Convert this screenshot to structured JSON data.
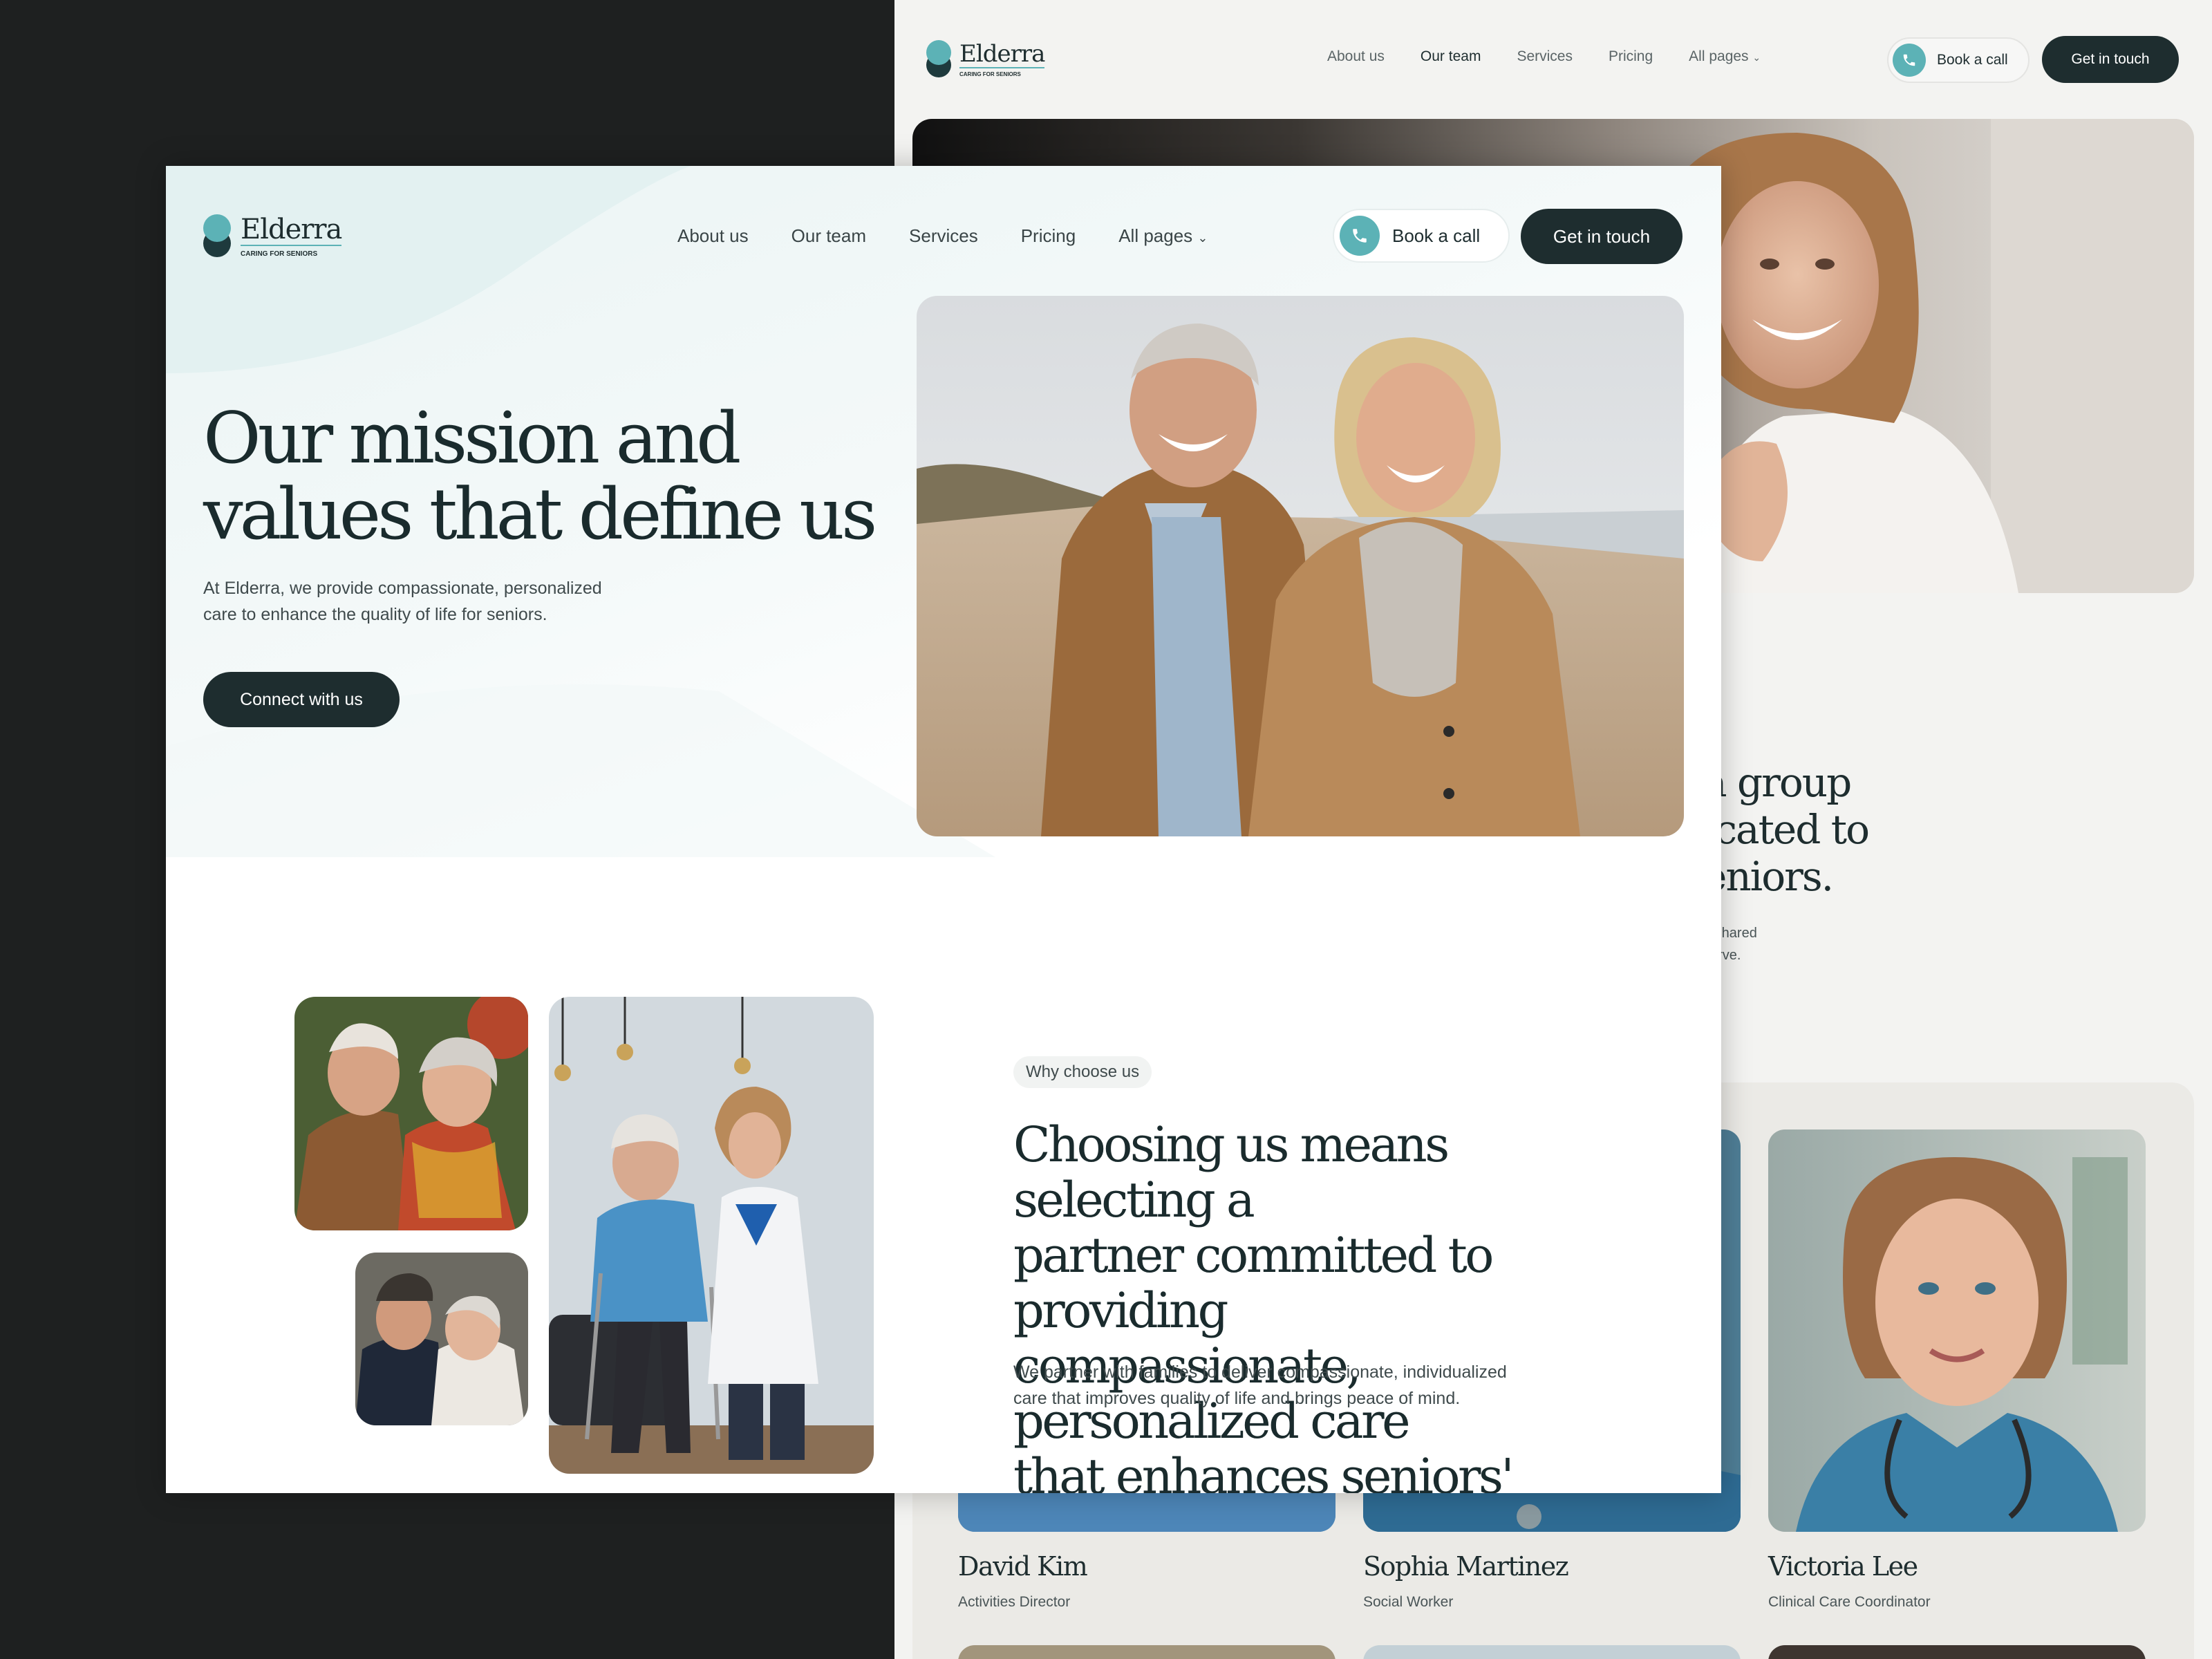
{
  "brand": {
    "name": "Elderra",
    "tagline": "CARING FOR SENIORS"
  },
  "colors": {
    "accent": "#5cb2b6",
    "dark": "#1e2d2f",
    "page_bg": "#1e2020"
  },
  "bg_page": {
    "nav": {
      "links": [
        "About us",
        "Our team",
        "Services",
        "Pricing",
        "All pages"
      ],
      "active": "Our team",
      "book_call": "Book a call",
      "get_in_touch": "Get in touch"
    },
    "heading_fragment": [
      "a group",
      "icated to",
      "eniors."
    ],
    "sub_fragment": [
      "a shared",
      "serve."
    ],
    "team": [
      {
        "name": "David Kim",
        "role": "Activities Director"
      },
      {
        "name": "Sophia Martinez",
        "role": "Social Worker"
      },
      {
        "name": "Victoria Lee",
        "role": "Clinical Care Coordinator"
      }
    ]
  },
  "front": {
    "nav": {
      "links": [
        "About us",
        "Our team",
        "Services",
        "Pricing",
        "All pages"
      ],
      "book_call": "Book a call",
      "get_in_touch": "Get in touch",
      "dropdown_icon": "chevron-down-icon",
      "phone_icon": "phone-icon"
    },
    "hero": {
      "title": [
        "Our mission and",
        "values that define us"
      ],
      "subtitle": [
        "At Elderra, we provide compassionate, personalized",
        "care to enhance the quality of life for seniors."
      ],
      "cta": "Connect with us"
    },
    "why": {
      "tag": "Why choose us",
      "title": [
        "Choosing us means selecting a",
        "partner committed to providing",
        "compassionate, personalized care",
        "that enhances seniors' lives."
      ],
      "subtitle": [
        "We partner with families to deliver compassionate, individualized",
        "care that improves quality of life and brings peace of mind."
      ]
    }
  }
}
